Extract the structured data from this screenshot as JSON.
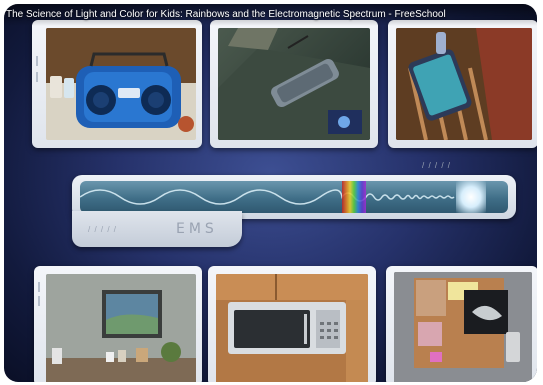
{
  "video": {
    "title": "The Science of Light and Color for Kids: Rainbows and the Electromagnetic Spectrum - FreeSchool"
  },
  "spectrum_panel": {
    "label": "EMS"
  },
  "colors": {
    "background": "#1d2657",
    "panel": "#e6eaf0",
    "wave_bar": "#4f7e97"
  },
  "cards": [
    {
      "icon": "radio-boombox-icon"
    },
    {
      "icon": "tv-remote-icon"
    },
    {
      "icon": "cellphone-icon"
    },
    {
      "icon": "television-icon"
    },
    {
      "icon": "microwave-icon"
    },
    {
      "icon": "xray-board-icon"
    }
  ]
}
